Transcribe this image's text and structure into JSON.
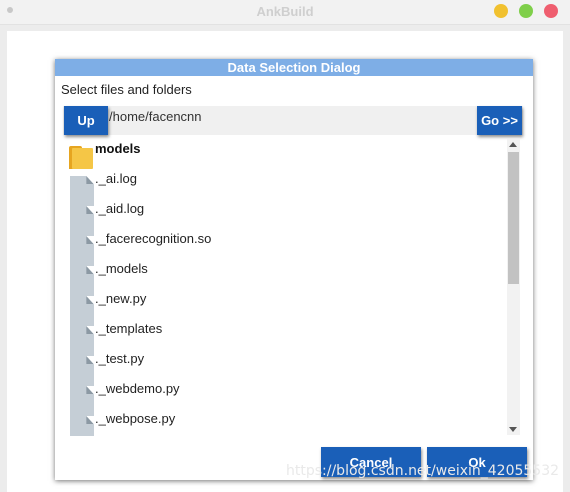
{
  "window": {
    "title": "AnkBuild"
  },
  "dialog": {
    "title": "Data Selection Dialog",
    "prompt": "Select files and folders",
    "path_value": "/home/facencnn",
    "up_label": "Up",
    "go_label": "Go >>",
    "cancel_label": "Cancel",
    "ok_label": "Ok"
  },
  "files": [
    {
      "name": "models",
      "type": "folder"
    },
    {
      "name": "._ai.log",
      "type": "file"
    },
    {
      "name": "._aid.log",
      "type": "file"
    },
    {
      "name": "._facerecognition.so",
      "type": "file"
    },
    {
      "name": "._models",
      "type": "file"
    },
    {
      "name": "._new.py",
      "type": "file"
    },
    {
      "name": "._templates",
      "type": "file"
    },
    {
      "name": "._test.py",
      "type": "file"
    },
    {
      "name": "._webdemo.py",
      "type": "file"
    },
    {
      "name": "._webpose.py",
      "type": "file"
    }
  ],
  "watermark": "https://blog.csdn.net/weixin_42055532",
  "colors": {
    "header": "#7eaee6",
    "button": "#1a5fb8",
    "folder": "#f5c646",
    "file_icon": "#c5ced6"
  }
}
